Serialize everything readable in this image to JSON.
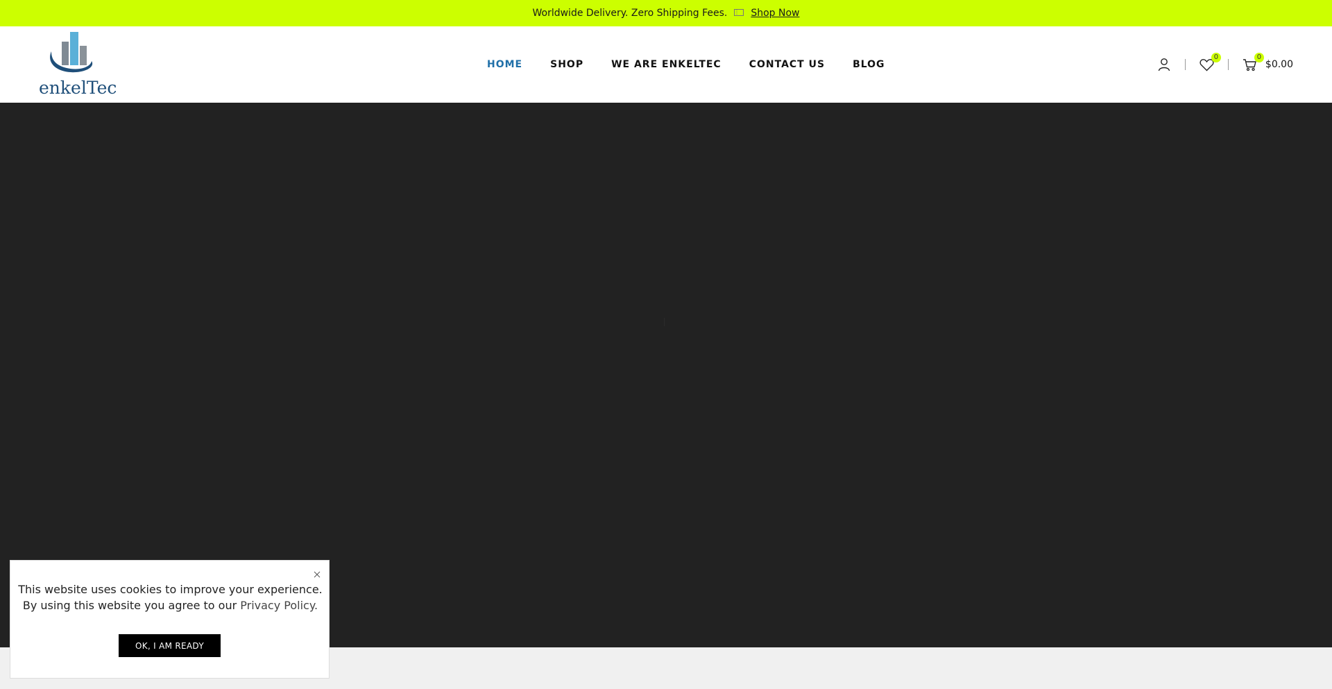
{
  "topbar": {
    "text": "Worldwide Delivery. Zero Shipping Fees.",
    "icon": "ticket-icon",
    "link": "Shop Now",
    "bg_color": "#ccff00"
  },
  "logo": {
    "text": "enkelTec",
    "icon": "building-bars-logo"
  },
  "nav": {
    "items": [
      {
        "label": "HOME",
        "active": true
      },
      {
        "label": "SHOP",
        "active": false
      },
      {
        "label": "WE ARE ENKELTEC",
        "active": false
      },
      {
        "label": "CONTACT US",
        "active": false
      },
      {
        "label": "BLOG",
        "active": false
      }
    ],
    "active_color": "#1f6fa8"
  },
  "header_icons": {
    "account_icon": "user-icon",
    "wishlist_icon": "heart-icon",
    "wishlist_count": "0",
    "cart_icon": "cart-icon",
    "cart_count": "0",
    "cart_total": "$0.00",
    "badge_color": "#ccff00"
  },
  "hero": {
    "bg_color": "#222222"
  },
  "cookie": {
    "line1": "This website uses cookies to improve your experience.",
    "line2_prefix": "By using this website you agree to our",
    "policy_link": "Privacy Policy.",
    "button": "OK, I AM READY",
    "close_icon": "close-icon"
  }
}
